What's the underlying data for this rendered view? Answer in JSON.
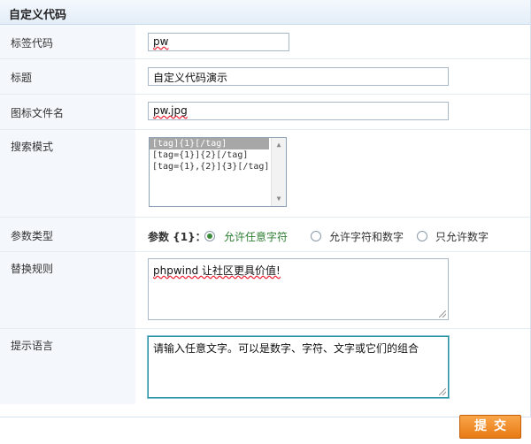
{
  "header": {
    "title": "自定义代码"
  },
  "rows": {
    "tag_code": {
      "label": "标签代码",
      "value": "pw"
    },
    "title": {
      "label": "标题",
      "value": "自定义代码演示"
    },
    "icon_file": {
      "label": "图标文件名",
      "value": "pw.jpg"
    },
    "search_mode": {
      "label": "搜索模式",
      "options": [
        "[tag]{1}[/tag]",
        "[tag={1}]{2}[/tag]",
        "[tag={1},{2}]{3}[/tag]"
      ],
      "selected_index": 0
    },
    "param_type": {
      "label": "参数类型",
      "param_label": "参数 {1}：",
      "options": [
        "允许任意字符",
        "允许字符和数字",
        "只允许数字"
      ],
      "selected_index": 0
    },
    "replace_rule": {
      "label": "替换规则",
      "value": "phpwind 让社区更具价值!"
    },
    "prompt_text": {
      "label": "提示语言",
      "value": "请输入任意文字。可以是数字、字符、文字或它们的组合"
    }
  },
  "submit_label": "提交",
  "colors": {
    "accent": "#e87a14",
    "selected_radio_text": "#2e7d32",
    "label_bg": "#f4f8fc"
  }
}
